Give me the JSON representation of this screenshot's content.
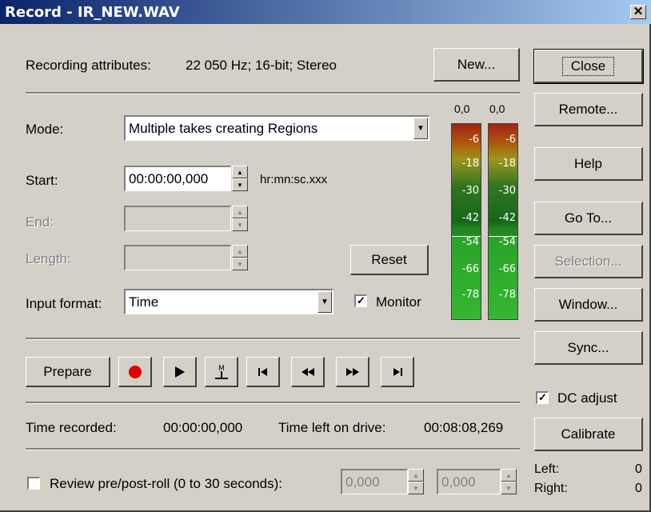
{
  "title": "Record - IR_NEW.WAV",
  "attributes": {
    "label": "Recording attributes:",
    "value": "22 050 Hz; 16-bit; Stereo"
  },
  "new_button": {
    "label": "New..."
  },
  "mode": {
    "label": "Mode:",
    "value": "Multiple takes creating Regions"
  },
  "start": {
    "label": "Start:",
    "value": "00:00:00,000",
    "unit": "hr:mn:sc.xxx"
  },
  "end": {
    "label": "End:",
    "value": ""
  },
  "length": {
    "label": "Length:",
    "value": ""
  },
  "reset_button": {
    "label": "Reset"
  },
  "input_format": {
    "label": "Input format:",
    "value": "Time"
  },
  "monitor": {
    "label": "Monitor",
    "checked": true
  },
  "meters": {
    "peak_left": "0,0",
    "peak_right": "0,0",
    "scale": [
      "-6",
      "-18",
      "-30",
      "-42",
      "-54",
      "-66",
      "-78"
    ]
  },
  "right_buttons": {
    "close": "Close",
    "remote": "Remote...",
    "help": "Help",
    "goto": "Go To...",
    "selection": "Selection...",
    "window": "Window...",
    "sync": "Sync...",
    "calibrate": "Calibrate"
  },
  "dc_adjust": {
    "label": "DC adjust",
    "checked": true
  },
  "transport": {
    "prepare": "Prepare",
    "icons": [
      "record-icon",
      "play-icon",
      "marker-icon",
      "go-to-start-icon",
      "rewind-icon",
      "fast-forward-icon",
      "go-to-end-icon"
    ]
  },
  "time_recorded": {
    "label": "Time recorded:",
    "value": "00:00:00,000"
  },
  "time_left": {
    "label": "Time left on drive:",
    "value": "00:08:08,269"
  },
  "review": {
    "label": "Review pre/post-roll (0 to 30 seconds):",
    "checked": false,
    "pre": "0,000",
    "post": "0,000"
  },
  "levels": {
    "left_label": "Left:",
    "left_value": "0",
    "right_label": "Right:",
    "right_value": "0"
  },
  "colors": {
    "title_start": "#0a246a",
    "title_end": "#a6caf0",
    "face": "#d4d0c8",
    "record_red": "#e00000"
  }
}
